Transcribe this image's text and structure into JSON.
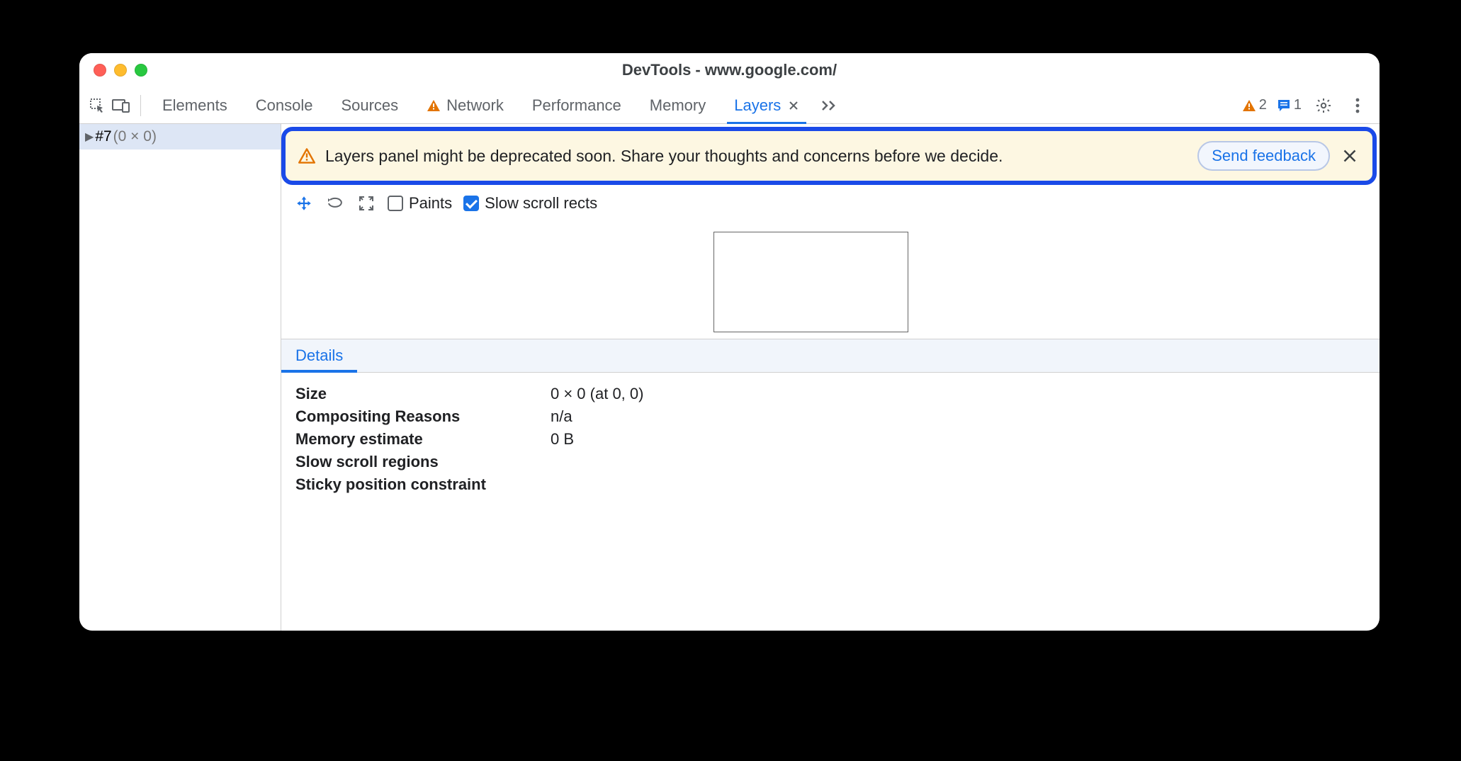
{
  "window": {
    "title": "DevTools - www.google.com/"
  },
  "tabs": {
    "elements": "Elements",
    "console": "Console",
    "sources": "Sources",
    "network": "Network",
    "performance": "Performance",
    "memory": "Memory",
    "layers": "Layers"
  },
  "status": {
    "warnings": "2",
    "messages": "1"
  },
  "tree": {
    "id": "#7",
    "dims": "(0 × 0)"
  },
  "banner": {
    "message": "Layers panel might be deprecated soon. Share your thoughts and concerns before we decide.",
    "button": "Send feedback"
  },
  "viewToolbar": {
    "paints": "Paints",
    "slowRects": "Slow scroll rects",
    "paintsChecked": false,
    "slowRectsChecked": true
  },
  "detailsTab": "Details",
  "details": {
    "sizeKey": "Size",
    "sizeVal": "0 × 0 (at 0, 0)",
    "compKey": "Compositing Reasons",
    "compVal": "n/a",
    "memKey": "Memory estimate",
    "memVal": "0 B",
    "slowKey": "Slow scroll regions",
    "slowVal": "",
    "stickyKey": "Sticky position constraint",
    "stickyVal": ""
  }
}
